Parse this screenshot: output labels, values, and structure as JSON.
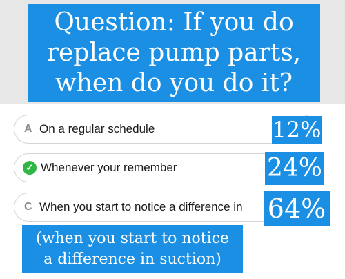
{
  "question": {
    "text": "Question: If you do replace pump parts, when do you do it?",
    "background_color": "#1a8fe3"
  },
  "options": [
    {
      "letter": "A",
      "label": "On a regular schedule",
      "percent": "12%",
      "selected": false
    },
    {
      "letter": "",
      "label": "Whenever your remember",
      "percent": "24%",
      "selected": true,
      "icon": "check-circle-icon"
    },
    {
      "letter": "C",
      "label": "When you start to notice a difference in",
      "percent": "64%",
      "selected": false
    }
  ],
  "note": {
    "line1": "(when you start to notice",
    "line2": "a difference in suction)"
  },
  "colors": {
    "accent": "#1a8fe3",
    "check": "#2fb644"
  }
}
